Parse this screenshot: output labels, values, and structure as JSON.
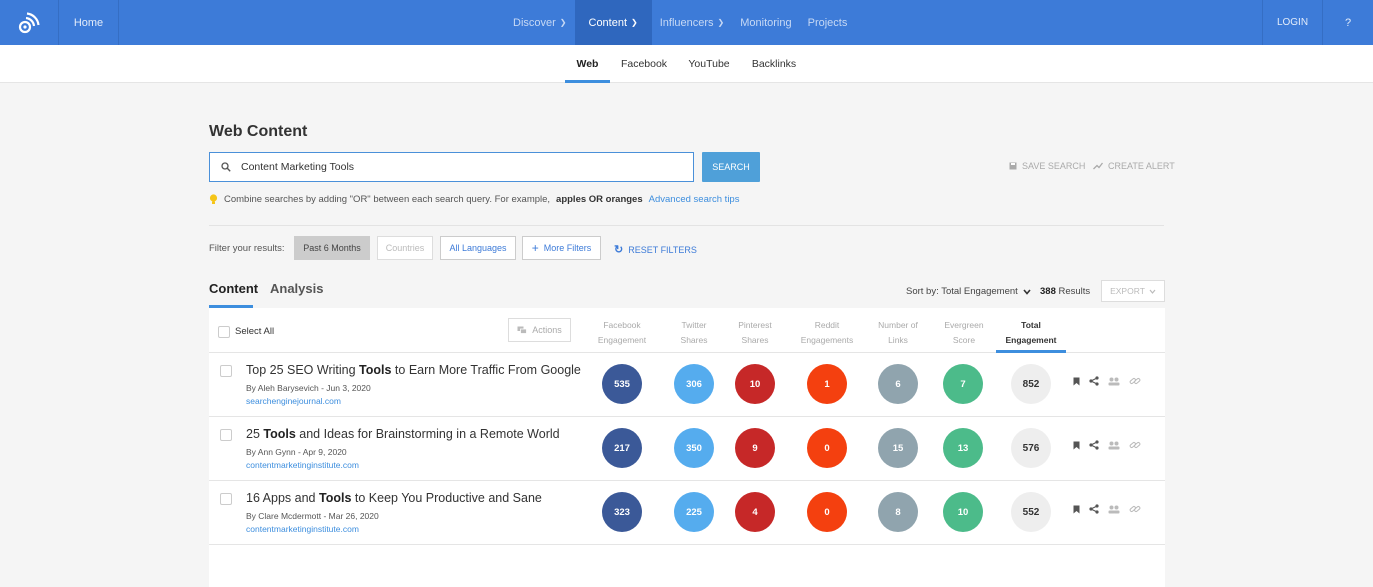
{
  "nav": {
    "home": "Home",
    "links": [
      {
        "label": "Discover",
        "has_menu": true,
        "active": false
      },
      {
        "label": "Content",
        "has_menu": true,
        "active": true
      },
      {
        "label": "Influencers",
        "has_menu": true,
        "active": false
      },
      {
        "label": "Monitoring",
        "has_menu": false,
        "active": false
      },
      {
        "label": "Projects",
        "has_menu": false,
        "active": false
      }
    ],
    "login": "LOGIN",
    "help": "?",
    "color": "#3d7bd8"
  },
  "subnav": {
    "tabs": [
      "Web",
      "Facebook",
      "YouTube",
      "Backlinks"
    ],
    "active": "Web"
  },
  "search": {
    "title": "Web Content",
    "query": "Content Marketing Tools",
    "button": "SEARCH",
    "save_search": "SAVE SEARCH",
    "create_alert": "CREATE ALERT",
    "tip_text": "Combine searches by adding \"OR\" between each search query. For example,",
    "tip_example": "apples OR oranges",
    "tip_link": "Advanced search tips"
  },
  "filters": {
    "label": "Filter your results:",
    "time": "Past 6 Months",
    "countries": "Countries",
    "languages": "All Languages",
    "more": "More Filters",
    "reset": "RESET FILTERS"
  },
  "content_tabs": {
    "tabs": [
      "Content",
      "Analysis"
    ],
    "active": "Content",
    "sort_label": "Sort by: Total Engagement",
    "results_count": "388",
    "results_label": "Results",
    "export": "EXPORT"
  },
  "table": {
    "select_all": "Select All",
    "actions": "Actions",
    "columns": [
      {
        "line1": "Facebook",
        "line2": "Engagement"
      },
      {
        "line1": "Twitter",
        "line2": "Shares"
      },
      {
        "line1": "Pinterest",
        "line2": "Shares"
      },
      {
        "line1": "Reddit",
        "line2": "Engagements"
      },
      {
        "line1": "Number of",
        "line2": "Links"
      },
      {
        "line1": "Evergreen",
        "line2": "Score"
      },
      {
        "line1": "Total",
        "line2": "Engagement"
      }
    ],
    "colors": {
      "facebook": "#3b5998",
      "twitter": "#55acee",
      "pinterest": "#c62828",
      "reddit": "#f4400f",
      "links": "#90a4ae",
      "evergreen": "#4cbb8a"
    },
    "rows": [
      {
        "title_pre": "Top 25 SEO Writing",
        "title_bold": "Tools",
        "title_post": "to Earn More Traffic From Google",
        "byline": "By Aleh Barysevich - Jun 3, 2020",
        "domain": "searchenginejournal.com",
        "facebook": "535",
        "twitter": "306",
        "pinterest": "10",
        "reddit": "1",
        "links": "6",
        "evergreen": "7",
        "total": "852"
      },
      {
        "title_pre": "25",
        "title_bold": "Tools",
        "title_post": "and Ideas for Brainstorming in a Remote World",
        "byline": "By Ann Gynn - Apr 9, 2020",
        "domain": "contentmarketinginstitute.com",
        "facebook": "217",
        "twitter": "350",
        "pinterest": "9",
        "reddit": "0",
        "links": "15",
        "evergreen": "13",
        "total": "576"
      },
      {
        "title_pre": "16 Apps and",
        "title_bold": "Tools",
        "title_post": "to Keep You Productive and Sane",
        "byline": "By Clare Mcdermott - Mar 26, 2020",
        "domain": "contentmarketinginstitute.com",
        "facebook": "323",
        "twitter": "225",
        "pinterest": "4",
        "reddit": "0",
        "links": "8",
        "evergreen": "10",
        "total": "552"
      }
    ]
  }
}
